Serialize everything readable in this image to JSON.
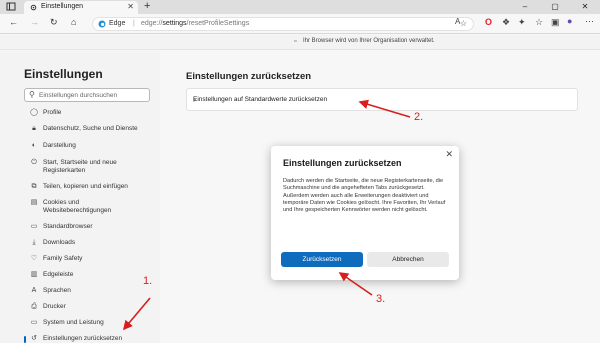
{
  "browser": {
    "tab_title": "Einstellungen",
    "tab_close_glyph": "✕",
    "new_tab_glyph": "+",
    "window_controls": [
      "–",
      "▢",
      "✕"
    ],
    "address": {
      "site_label": "Edge",
      "separator": "|",
      "url_prefix": "edge://",
      "url_path": "settings",
      "url_suffix": "/resetProfileSettings"
    },
    "managed_notice": "Ihr Browser wird von Ihrer Organisation verwaltet."
  },
  "sidebar": {
    "title": "Einstellungen",
    "search_placeholder": "Einstellungen durchsuchen",
    "items": [
      {
        "label": "Profile",
        "icon": "profile-icon"
      },
      {
        "label": "Datenschutz, Suche und Dienste",
        "icon": "lock-icon"
      },
      {
        "label": "Darstellung",
        "icon": "appearance-icon"
      },
      {
        "label": "Start, Startseite und neue Registerkarten",
        "icon": "power-icon"
      },
      {
        "label": "Teilen, kopieren und einfügen",
        "icon": "share-icon"
      },
      {
        "label": "Cookies und Websiteberechtigungen",
        "icon": "cookie-icon"
      },
      {
        "label": "Standardbrowser",
        "icon": "browser-icon"
      },
      {
        "label": "Downloads",
        "icon": "download-icon"
      },
      {
        "label": "Family Safety",
        "icon": "family-icon"
      },
      {
        "label": "Edgeleiste",
        "icon": "sidebar-icon"
      },
      {
        "label": "Sprachen",
        "icon": "language-icon"
      },
      {
        "label": "Drucker",
        "icon": "printer-icon"
      },
      {
        "label": "System und Leistung",
        "icon": "system-icon"
      },
      {
        "label": "Einstellungen zurücksetzen",
        "icon": "reset-icon"
      }
    ]
  },
  "main": {
    "title": "Einstellungen zurücksetzen",
    "card_label": "Einstellungen auf Standardwerte zurücksetzen"
  },
  "dialog": {
    "title": "Einstellungen zurücksetzen",
    "body": "Dadurch werden die Startseite, die neue Registerkartenseite, die Suchmaschine und die angehefteten Tabs zurückgesetzt. Außerdem werden auch alle Erweiterungen deaktiviert und temporäre Daten wie Cookies gelöscht. Ihre Favoriten, Ihr Verlauf und Ihre gespeicherten Kennwörter werden nicht gelöscht.",
    "confirm_label": "Zurücksetzen",
    "cancel_label": "Abbrechen"
  },
  "annotations": [
    "1.",
    "2.",
    "3."
  ],
  "colors": {
    "accent": "#0f6cbd",
    "annotation": "#d81e1e"
  }
}
